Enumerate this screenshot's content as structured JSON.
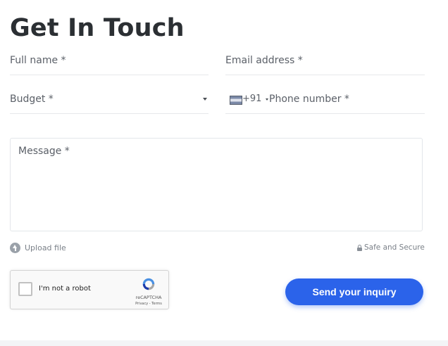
{
  "form": {
    "title": "Get In Touch",
    "full_name_placeholder": "Full name *",
    "email_placeholder": "Email address *",
    "budget_placeholder": "Budget *",
    "phone_country_code": "+91",
    "phone_placeholder": "Phone number *",
    "message_placeholder": "Message *",
    "upload_label": "Upload file",
    "secure_label": "Safe and Secure",
    "submit_label": "Send your inquiry"
  },
  "recaptcha": {
    "label": "I'm not a robot",
    "brand": "reCAPTCHA",
    "terms": "Privacy - Terms"
  },
  "colors": {
    "accent": "#2b63ea",
    "text": "#2b2f33",
    "muted": "#7a8088"
  },
  "icons": [
    "upload-icon",
    "lock-icon",
    "chevron-down-icon",
    "india-flag-icon",
    "recaptcha-logo-icon"
  ]
}
